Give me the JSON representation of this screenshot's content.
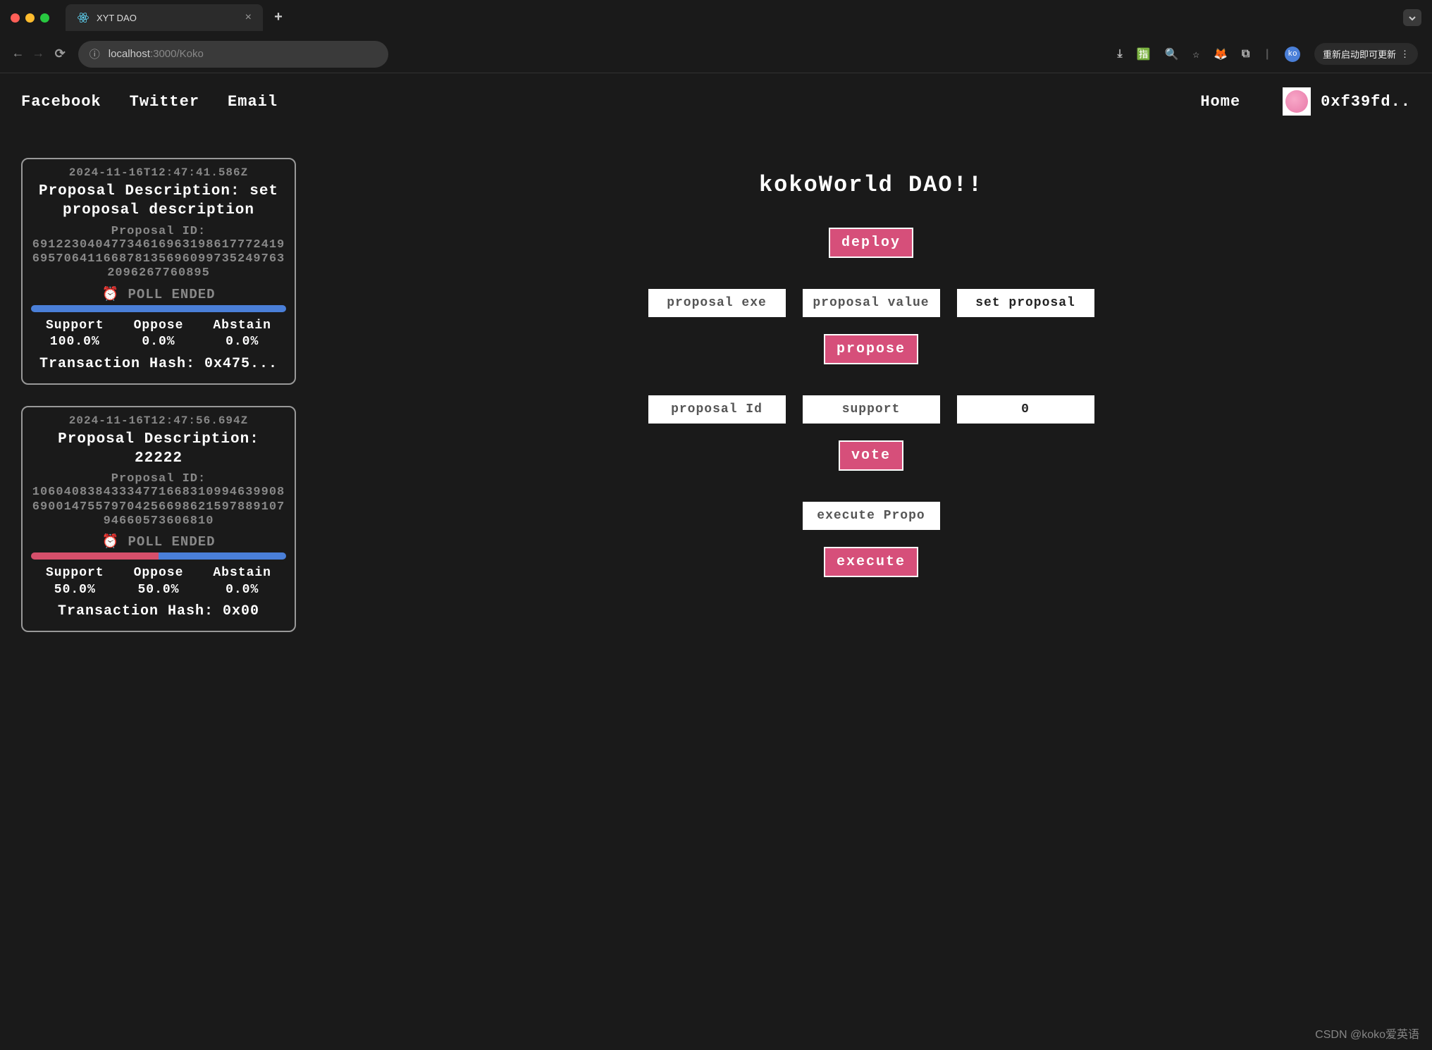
{
  "browser": {
    "tab_title": "XYT DAO",
    "url_host": "localhost",
    "url_port": ":3000",
    "url_path": "/Koko",
    "restart_label": "重新启动即可更新",
    "profile_badge": "ko"
  },
  "nav": {
    "links": [
      "Facebook",
      "Twitter",
      "Email"
    ],
    "home": "Home",
    "wallet": "0xf39fd.."
  },
  "main": {
    "title": "kokoWorld DAO!!",
    "deploy_btn": "deploy",
    "propose": {
      "placeholders": [
        "proposal exe",
        "proposal value",
        "set proposal"
      ],
      "input3_value": "set proposal",
      "btn": "propose"
    },
    "vote": {
      "placeholders": [
        "proposal Id",
        "support"
      ],
      "input3_value": "0",
      "btn": "vote"
    },
    "execute": {
      "placeholder": "execute Propo",
      "btn": "execute"
    }
  },
  "proposals": [
    {
      "timestamp": "2024-11-16T12:47:41.586Z",
      "description": "Proposal Description: set proposal description",
      "id_label": "Proposal ID:",
      "id_value": "69122304047734616963198617772419695706411668781356960997352497632096267760895",
      "status": "⏰ POLL ENDED",
      "support_label": "Support",
      "support_pct": "100.0%",
      "oppose_label": "Oppose",
      "oppose_pct": "0.0%",
      "abstain_label": "Abstain",
      "abstain_pct": "0.0%",
      "tx_label": "Transaction Hash: 0x475...",
      "bar_support": 100,
      "bar_oppose": 0
    },
    {
      "timestamp": "2024-11-16T12:47:56.694Z",
      "description": "Proposal Description: 22222",
      "id_label": "Proposal ID:",
      "id_value": "106040838433347716683109946399086900147557970425669862159788910794660573606810",
      "status": "⏰ POLL ENDED",
      "support_label": "Support",
      "support_pct": "50.0%",
      "oppose_label": "Oppose",
      "oppose_pct": "50.0%",
      "abstain_label": "Abstain",
      "abstain_pct": "0.0%",
      "tx_label": "Transaction Hash: 0x00",
      "bar_support": 50,
      "bar_oppose": 50
    }
  ],
  "watermark": "CSDN @koko爱英语"
}
